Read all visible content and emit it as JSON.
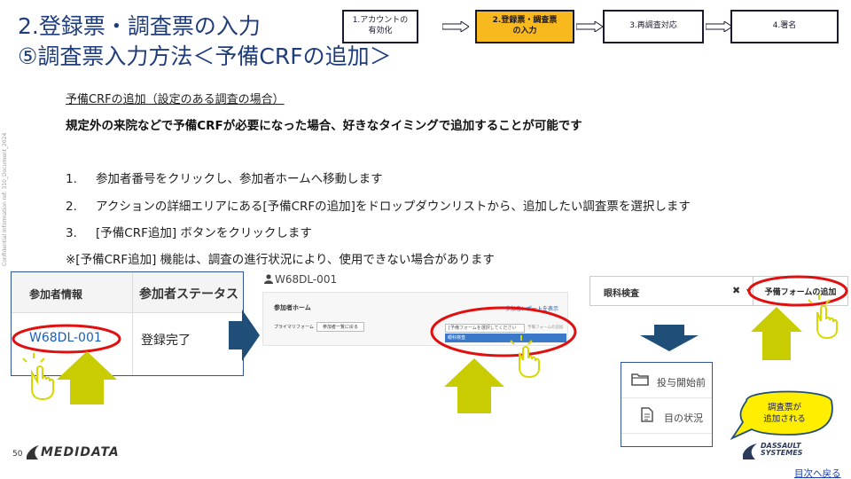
{
  "title": {
    "line1": "2.登録票・調査票の入力",
    "line2": "⑤調査票入力方法＜予備CRFの追加＞"
  },
  "steps": [
    {
      "label": "1.アカウントの\n有効化",
      "active": false
    },
    {
      "label": "2.登録票・調査票\nの入力",
      "active": true
    },
    {
      "label": "3.再調査対応",
      "active": false
    },
    {
      "label": "4.署名",
      "active": false
    }
  ],
  "subheading": "予備CRFの追加（設定のある調査の場合）",
  "lead": "規定外の来院などで予備CRFが必要になった場合、好きなタイミングで追加することが可能です",
  "instructions": [
    {
      "num": "1.",
      "text": "参加者番号をクリックし、参加者ホームへ移動します"
    },
    {
      "num": "2.",
      "text": "アクションの詳細エリアにある[予備CRFの追加]をドロップダウンリストから、追加したい調査票を選択します"
    },
    {
      "num": "3.",
      "text": "[予備CRF追加] ボタンをクリックします"
    }
  ],
  "note": "※[予備CRF追加] 機能は、調査の進行状況により、使用できない場合があります",
  "confidential": "Confidential Information ref: 310_Document_2024",
  "panel1": {
    "col1": "参加者情報",
    "col2": "参加者ステータス",
    "subject_id": "W68DL-001",
    "status": "登録完了"
  },
  "panel2": {
    "subject_id": "W68DL-001",
    "home_title": "参加者ホーム",
    "report_link": "参加者レポートを表示",
    "primary_form": "プライマリフォーム",
    "list_button": "参加者一覧に戻る",
    "select_placeholder": "[予備フォームを選択してください",
    "select_button": "予備フォームの追加",
    "option": "眼科検査"
  },
  "panel3": {
    "selected": "眼科検査",
    "clear": "✖",
    "caret": "▾",
    "add_button": "予備フォームの追加"
  },
  "panel4": {
    "item1": "投与開始前",
    "item2": "目の状況"
  },
  "bubble": "調査票が\n追加される",
  "footer": {
    "page": "50",
    "brand": "MEDIDATA",
    "ds_brand": "DASSAULT\nSYSTEMES",
    "back_link": "目次へ戻る"
  },
  "colors": {
    "title": "#1f3d7a",
    "highlight_ring": "#e01010",
    "arrow_lime": "#c8cc00",
    "arrow_navy": "#1f4e79",
    "step_active": "#f7b91e",
    "bubble": "#ffee00"
  },
  "icons": [
    "folder-icon",
    "document-icon",
    "tap-hand-icon",
    "arrow-right-icon",
    "arrow-up-icon",
    "arrow-down-icon",
    "user-icon"
  ]
}
